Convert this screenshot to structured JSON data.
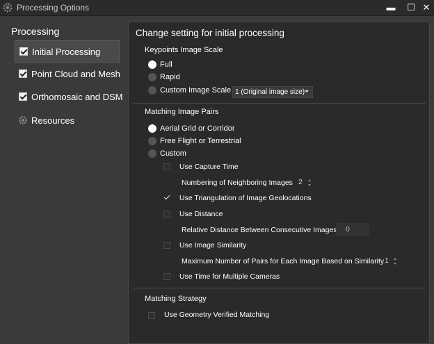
{
  "window": {
    "title": "Processing Options",
    "icon": "gear-icon",
    "controls": {
      "minimize": "▬",
      "maximize": "☐",
      "close": "✕"
    }
  },
  "sidebar": {
    "heading": "Processing",
    "items": [
      {
        "label": "Initial Processing",
        "checked": true,
        "active": true
      },
      {
        "label": "Point Cloud and Mesh",
        "checked": true
      },
      {
        "label": "Orthomosaic and DSM",
        "checked": true
      },
      {
        "label": "Resources",
        "icon": "gear-icon"
      }
    ]
  },
  "panel": {
    "title": "Change setting for initial processing",
    "keypoints": {
      "title": "Keypoints Image Scale",
      "options": [
        {
          "label": "Full",
          "selected": true
        },
        {
          "label": "Rapid",
          "selected": false
        },
        {
          "label": "Custom Image Scale",
          "selected": false
        }
      ],
      "custom_scale_value": "1 (Original image size)"
    },
    "matching": {
      "title": "Matching Image Pairs",
      "options": [
        {
          "label": "Aerial Grid or Corridor",
          "selected": true
        },
        {
          "label": "Free Flight or Terrestrial",
          "selected": false
        },
        {
          "label": "Custom",
          "selected": false
        }
      ],
      "use_capture_time": {
        "label": "Use Capture Time",
        "checked": false
      },
      "neighboring": {
        "label": "Numbering of Neighboring Images",
        "value": "2"
      },
      "triangulation": {
        "label": "Use Triangulation of Image Geolocations",
        "checked": true
      },
      "distance": {
        "label": "Use Distance",
        "checked": false
      },
      "relative_distance": {
        "label": "Relative Distance Between Consecutive Images",
        "value": "0"
      },
      "similarity": {
        "label": "Use Image Similarity",
        "checked": false
      },
      "max_pairs": {
        "label": "Maximum Number of Pairs for Each Image Based on Similarity",
        "value": "1"
      },
      "multi_cameras": {
        "label": "Use Time for Multiple Cameras",
        "checked": false
      }
    },
    "strategy": {
      "title": "Matching Strategy",
      "geometry_verified": {
        "label": "Use Geometry Verified Matching",
        "checked": false
      }
    }
  }
}
